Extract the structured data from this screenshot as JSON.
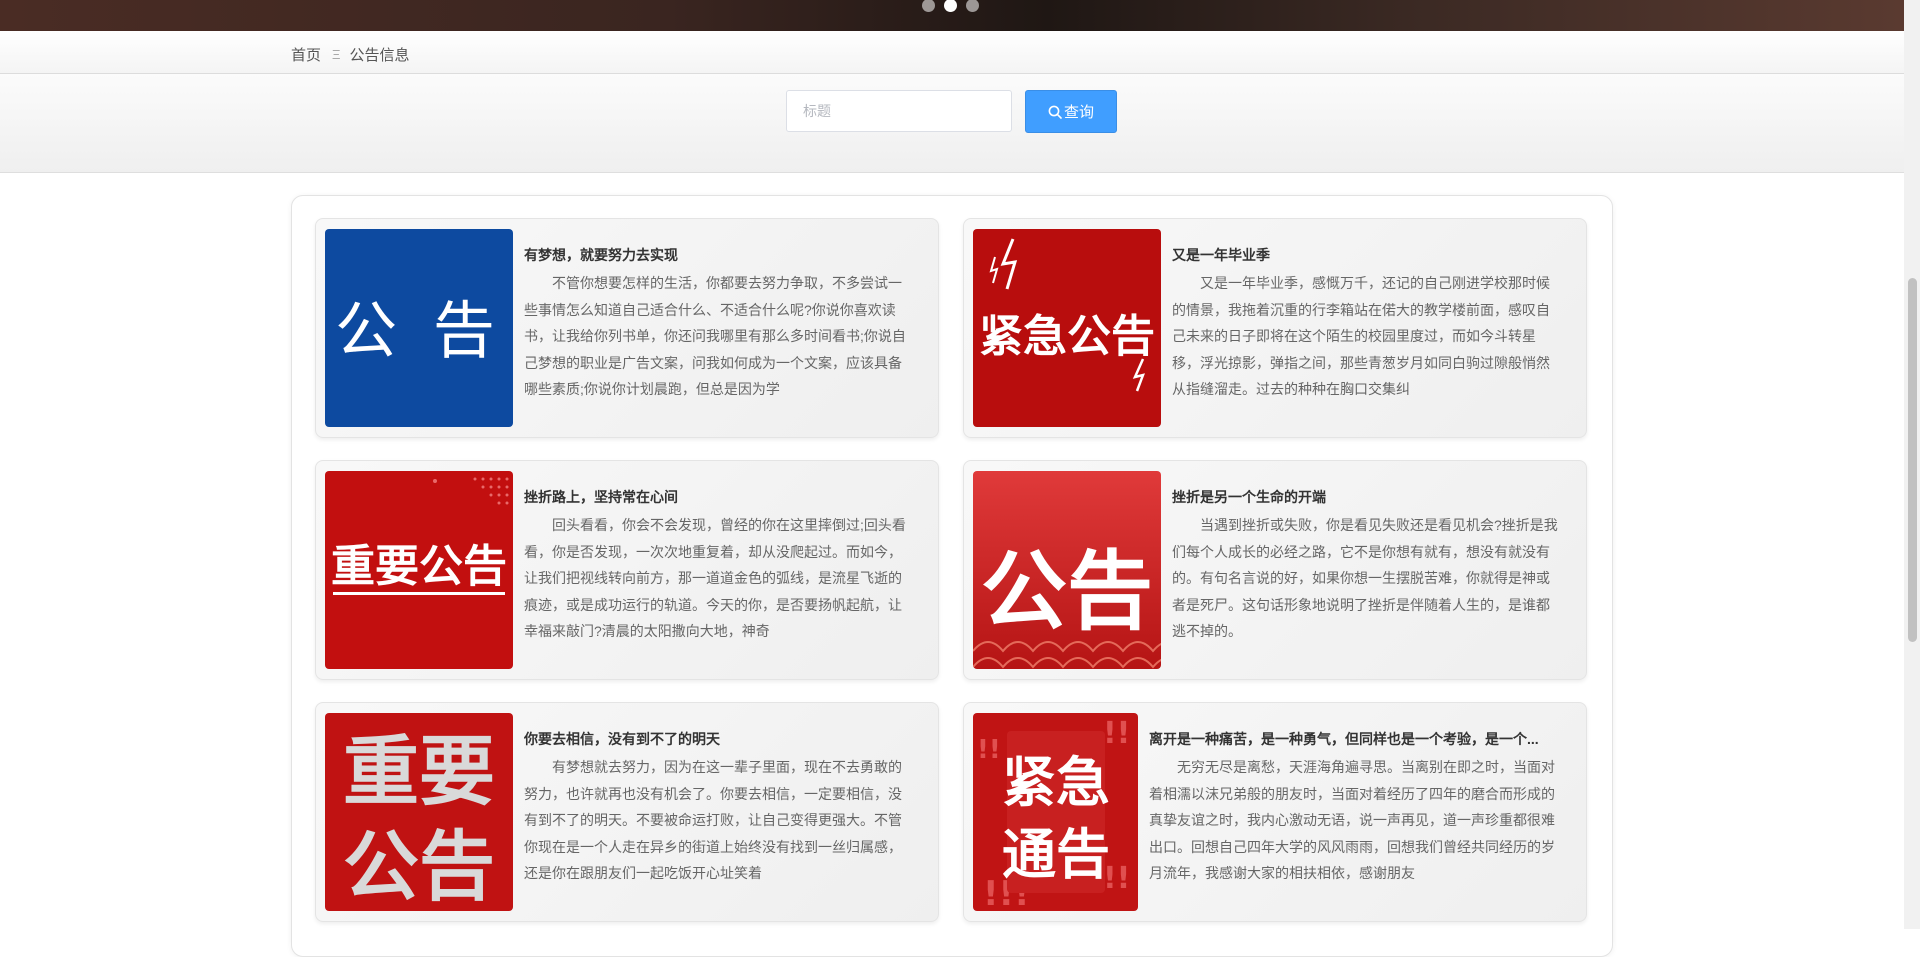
{
  "breadcrumb": {
    "home": "首页",
    "separator": "Ξ",
    "current": "公告信息"
  },
  "search": {
    "placeholder": "标题",
    "button_label": "查询"
  },
  "colors": {
    "primary": "#409eff",
    "thumb_blue": "#0d4aa0",
    "thumb_red": "#c20f0f"
  },
  "notices": [
    {
      "title": "有梦想，就要努力去实现",
      "content": "不管你想要怎样的生活，你都要去努力争取，不多尝试一些事情怎么知道自己适合什么、不适合什么呢?你说你喜欢读书，让我给你列书单，你还问我哪里有那么多时间看书;你说自己梦想的职业是广告文案，问我如何成为一个文案，应该具备哪些素质;你说你计划晨跑，但总是因为学",
      "thumb_text": "公 告"
    },
    {
      "title": "又是一年毕业季",
      "content": "又是一年毕业季，感慨万千，还记的自己刚进学校那时候的情景，我拖着沉重的行李箱站在偌大的教学楼前面，感叹自己未来的日子即将在这个陌生的校园里度过，而如今斗转星移，浮光掠影，弹指之间，那些青葱岁月如同白驹过隙般悄然从指缝溜走。过去的种种在胸口交集纠",
      "thumb_text": "紧急公告"
    },
    {
      "title": "挫折路上，坚持常在心间",
      "content": "回头看看，你会不会发现，曾经的你在这里摔倒过;回头看看，你是否发现，一次次地重复着，却从没爬起过。而如今，让我们把视线转向前方，那一道道金色的弧线，是流星飞逝的痕迹，或是成功运行的轨道。今天的你，是否要扬帆起航，让幸福来敲门?清晨的太阳撒向大地，神奇",
      "thumb_text": "重要公告"
    },
    {
      "title": "挫折是另一个生命的开端",
      "content": "当遇到挫折或失败，你是看见失败还是看见机会?挫折是我们每个人成长的必经之路，它不是你想有就有，想没有就没有的。有句名言说的好，如果你想一生摆脱苦难，你就得是神或者是死尸。这句话形象地说明了挫折是伴随着人生的，是谁都逃不掉的。",
      "thumb_text": "公告"
    },
    {
      "title": "你要去相信，没有到不了的明天",
      "content": "有梦想就去努力，因为在这一辈子里面，现在不去勇敢的努力，也许就再也没有机会了。你要去相信，一定要相信，没有到不了的明天。不要被命运打败，让自己变得更强大。不管你现在是一个人走在异乡的街道上始终没有找到一丝归属感，还是你在跟朋友们一起吃饭开心址笑着",
      "thumb_text_line1": "重要",
      "thumb_text_line2": "公告"
    },
    {
      "title": "离开是一种痛苦，是一种勇气，但同样也是一个考验，是一个...",
      "content": "无穷无尽是离愁，天涯海角遍寻思。当离别在即之时，当面对着相濡以沫兄弟般的朋友时，当面对着经历了四年的磨合而形成的真挚友谊之时，我内心激动无语，说一声再见，道一声珍重都很难出口。回想自己四年大学的风风雨雨，回想我们曾经共同经历的岁月流年，我感谢大家的相扶相依，感谢朋友",
      "thumb_text_line1": "紧急",
      "thumb_text_line2": "通告"
    }
  ]
}
